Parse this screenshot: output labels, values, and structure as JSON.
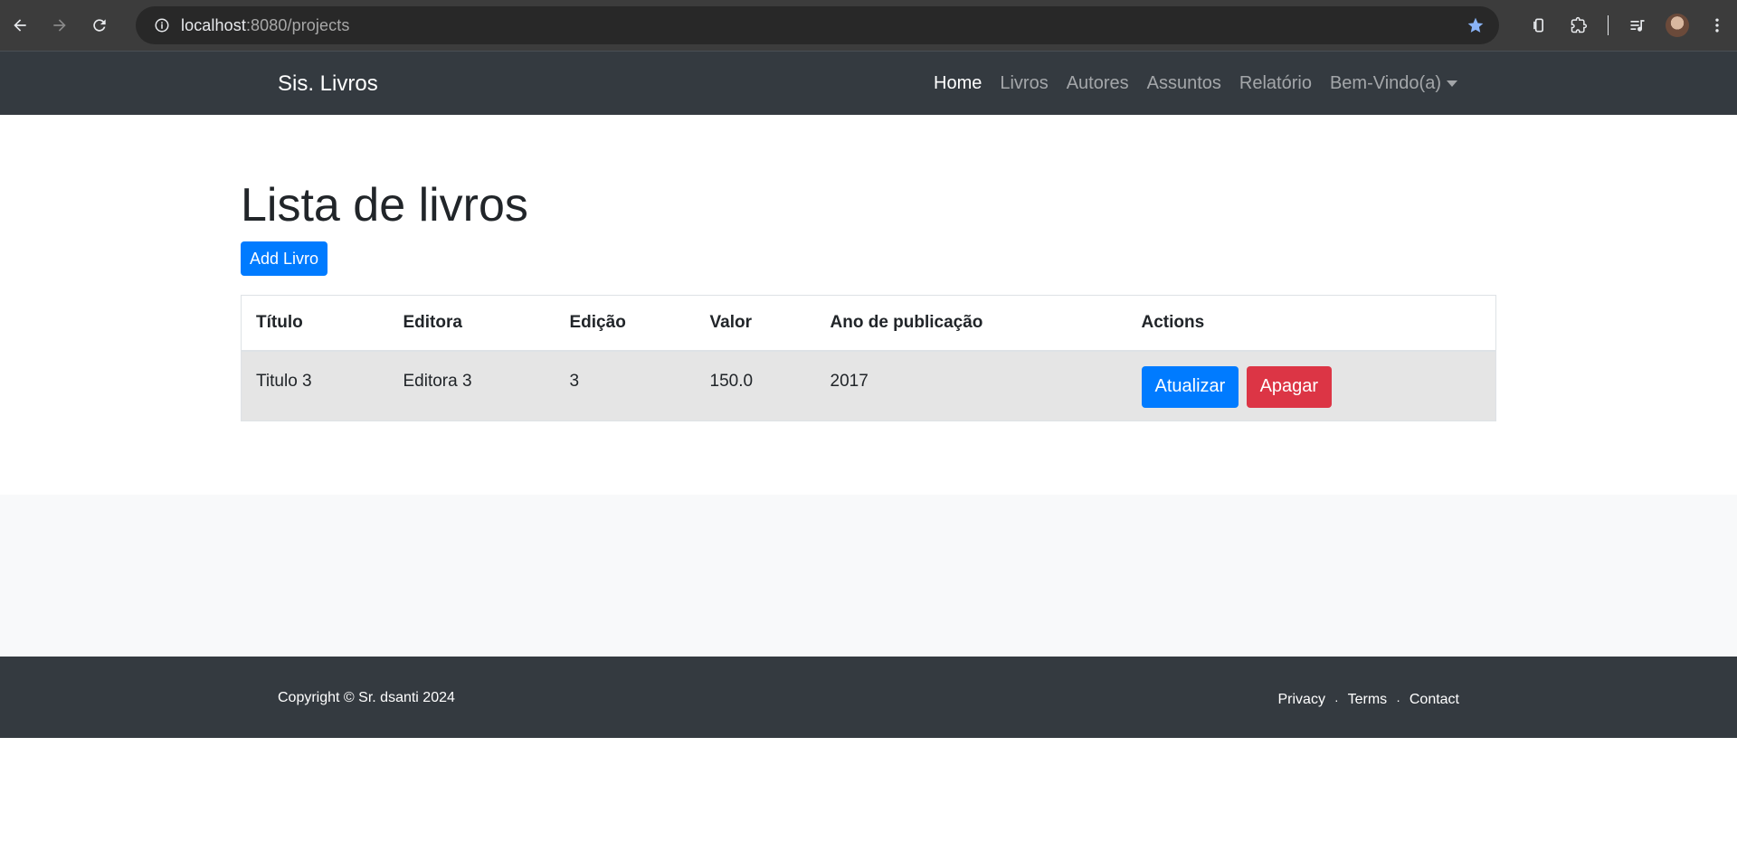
{
  "browser": {
    "url_host": "localhost",
    "url_rest": ":8080/projects"
  },
  "navbar": {
    "brand": "Sis. Livros",
    "links": [
      {
        "label": "Home"
      },
      {
        "label": "Livros"
      },
      {
        "label": "Autores"
      },
      {
        "label": "Assuntos"
      },
      {
        "label": "Relatório"
      },
      {
        "label": "Bem-Vindo(a)"
      }
    ]
  },
  "main": {
    "title": "Lista de livros",
    "add_button": "Add Livro",
    "table": {
      "headers": [
        "Título",
        "Editora",
        "Edição",
        "Valor",
        "Ano de publicação",
        "Actions"
      ],
      "rows": [
        {
          "titulo": "Titulo 3",
          "editora": "Editora 3",
          "edicao": "3",
          "valor": "150.0",
          "ano": "2017",
          "update_label": "Atualizar",
          "delete_label": "Apagar"
        }
      ]
    }
  },
  "footer": {
    "copyright": "Copyright © Sr. dsanti 2024",
    "links": [
      "Privacy",
      "Terms",
      "Contact"
    ],
    "separator": "·"
  },
  "colors": {
    "navbar_bg": "#343a40",
    "primary": "#007bff",
    "danger": "#dc3545"
  }
}
